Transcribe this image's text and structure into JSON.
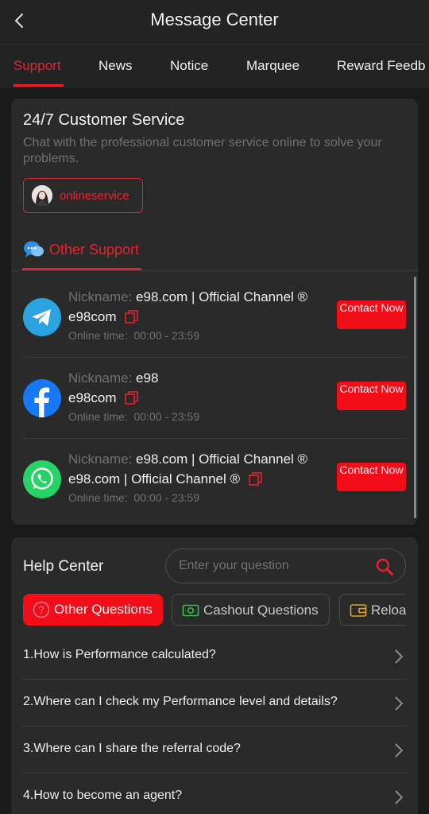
{
  "header": {
    "title": "Message Center"
  },
  "tabs": [
    {
      "label": "Support"
    },
    {
      "label": "News"
    },
    {
      "label": "Notice"
    },
    {
      "label": "Marquee"
    },
    {
      "label": "Reward Feedb"
    }
  ],
  "support": {
    "title": "24/7 Customer Service",
    "description": "Chat with the professional customer service online to solve your problems.",
    "online_button": "onlineservice",
    "other_support_label": "Other Support",
    "nickname_label": "Nickname:",
    "online_time_label": "Online time:",
    "contact_label": "Contact Now",
    "channels": [
      {
        "icon": "telegram-icon",
        "nickname": "e98.com | Official Channel ®",
        "id": "e98com",
        "online_time": "00:00 - 23:59"
      },
      {
        "icon": "facebook-icon",
        "nickname": "e98",
        "id": "e98com",
        "online_time": "00:00 - 23:59"
      },
      {
        "icon": "whatsapp-icon",
        "nickname": "e98.com | Official Channel ®",
        "id": "e98.com | Official Channel ®",
        "online_time": "00:00 - 23:59"
      }
    ]
  },
  "help": {
    "title": "Help Center",
    "search_placeholder": "Enter your question",
    "categories": [
      {
        "label": "Other Questions",
        "icon": "question-icon"
      },
      {
        "label": "Cashout Questions",
        "icon": "cash-icon"
      },
      {
        "label": "Reload",
        "icon": "wallet-icon"
      }
    ],
    "questions": [
      "1.How is Performance calculated?",
      "2.Where can I check my Performance level and details?",
      "3.Where can I share the referral code?",
      "4.How to become an agent?"
    ]
  },
  "colors": {
    "accent": "#e8212e",
    "button": "#f30d18",
    "background": "#1a1a1a",
    "card": "#2a2a2a"
  }
}
